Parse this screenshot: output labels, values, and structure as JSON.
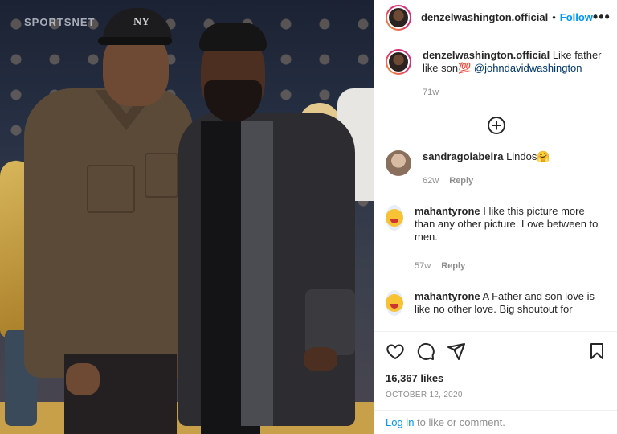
{
  "photo": {
    "arena_sign": "SPORTSNET"
  },
  "header": {
    "username": "denzelwashington.official",
    "separator": "•",
    "follow_label": "Follow",
    "more_label": "•••"
  },
  "caption": {
    "username": "denzelwashington.official",
    "text": "Like father like son💯",
    "mention": "@johndavidwashington",
    "age": "71w"
  },
  "comments": [
    {
      "username": "sandragoiabeira",
      "text": "Lindos🤗",
      "age": "62w",
      "reply_label": "Reply"
    },
    {
      "username": "mahantyrone",
      "text": "I like this picture more than any other picture. Love between to men.",
      "age": "57w",
      "reply_label": "Reply"
    },
    {
      "username": "mahantyrone",
      "text": "A Father and son love is like no other love. Big shoutout for",
      "age": "",
      "reply_label": ""
    }
  ],
  "actions": {
    "icons": [
      "heart-icon",
      "comment-icon",
      "share-icon",
      "bookmark-icon"
    ],
    "likes": "16,367 likes",
    "date": "OCTOBER 12, 2020"
  },
  "footer": {
    "login_link": "Log in",
    "login_rest": " to like or comment."
  }
}
